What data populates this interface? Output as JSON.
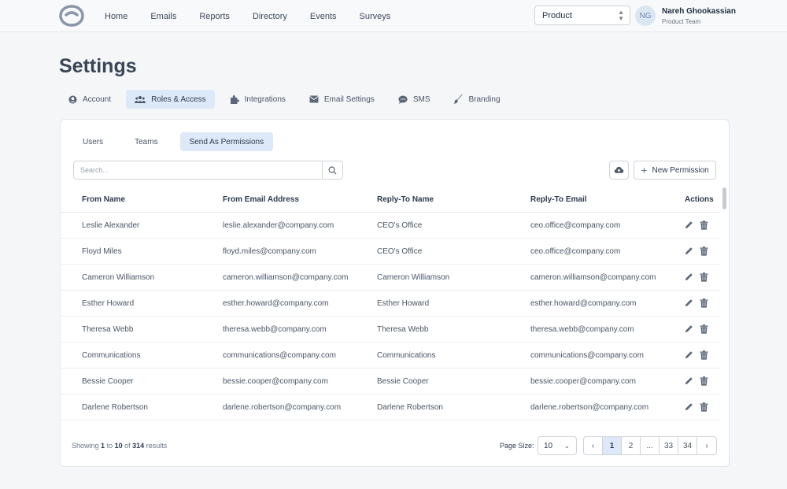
{
  "nav": {
    "items": [
      "Home",
      "Emails",
      "Reports",
      "Directory",
      "Events",
      "Surveys"
    ]
  },
  "team_select": {
    "value": "Product"
  },
  "user": {
    "initials": "NG",
    "name": "Nareh Ghookassian",
    "team": "Product Team"
  },
  "page_title": "Settings",
  "main_tabs": [
    {
      "label": "Account",
      "icon": "user-circle-icon"
    },
    {
      "label": "Roles & Access",
      "icon": "users-icon",
      "active": true
    },
    {
      "label": "Integrations",
      "icon": "puzzle-icon"
    },
    {
      "label": "Email Settings",
      "icon": "envelope-icon"
    },
    {
      "label": "SMS",
      "icon": "chat-bubble-icon"
    },
    {
      "label": "Branding",
      "icon": "brush-icon"
    }
  ],
  "sub_tabs": [
    {
      "label": "Users"
    },
    {
      "label": "Teams"
    },
    {
      "label": "Send As Permissions",
      "active": true
    }
  ],
  "search": {
    "placeholder": "Search..."
  },
  "new_button": "New Permission",
  "table": {
    "headers": [
      "From Name",
      "From Email Address",
      "Reply-To Name",
      "Reply-To Email",
      "Actions"
    ],
    "rows": [
      [
        "Leslie Alexander",
        "leslie.alexander@company.com",
        "CEO's Office",
        "ceo.office@company.com"
      ],
      [
        "Floyd Miles",
        "floyd.miles@company.com",
        "CEO's Office",
        "ceo.office@company.com"
      ],
      [
        "Cameron Williamson",
        "cameron.williamson@company.com",
        "Cameron Williamson",
        "cameron.williamson@company.com"
      ],
      [
        "Esther Howard",
        "esther.howard@company.com",
        "Esther Howard",
        "esther.howard@company.com"
      ],
      [
        "Theresa Webb",
        "theresa.webb@company.com",
        "Theresa Webb",
        "theresa.webb@company.com"
      ],
      [
        "Communications",
        "communications@company.com",
        "Communications",
        "communications@company.com"
      ],
      [
        "Bessie Cooper",
        "bessie.cooper@company.com",
        "Bessie Cooper",
        "bessie.cooper@company.com"
      ],
      [
        "Darlene Robertson",
        "darlene.robertson@company.com",
        "Darlene Robertson",
        "darlene.robertson@company.com"
      ]
    ]
  },
  "footer": {
    "showing_prefix": "Showing",
    "from": "1",
    "to_word": "to",
    "to": "10",
    "of_word": "of",
    "total": "314",
    "suffix": "results",
    "page_size_label": "Page Size:",
    "page_size_value": "10",
    "pages": [
      "‹",
      "1",
      "2",
      "...",
      "33",
      "34",
      "›"
    ],
    "active_page": "1"
  },
  "colors": {
    "accent_bg": "#dde9f8",
    "text": "#2d3b4e"
  }
}
